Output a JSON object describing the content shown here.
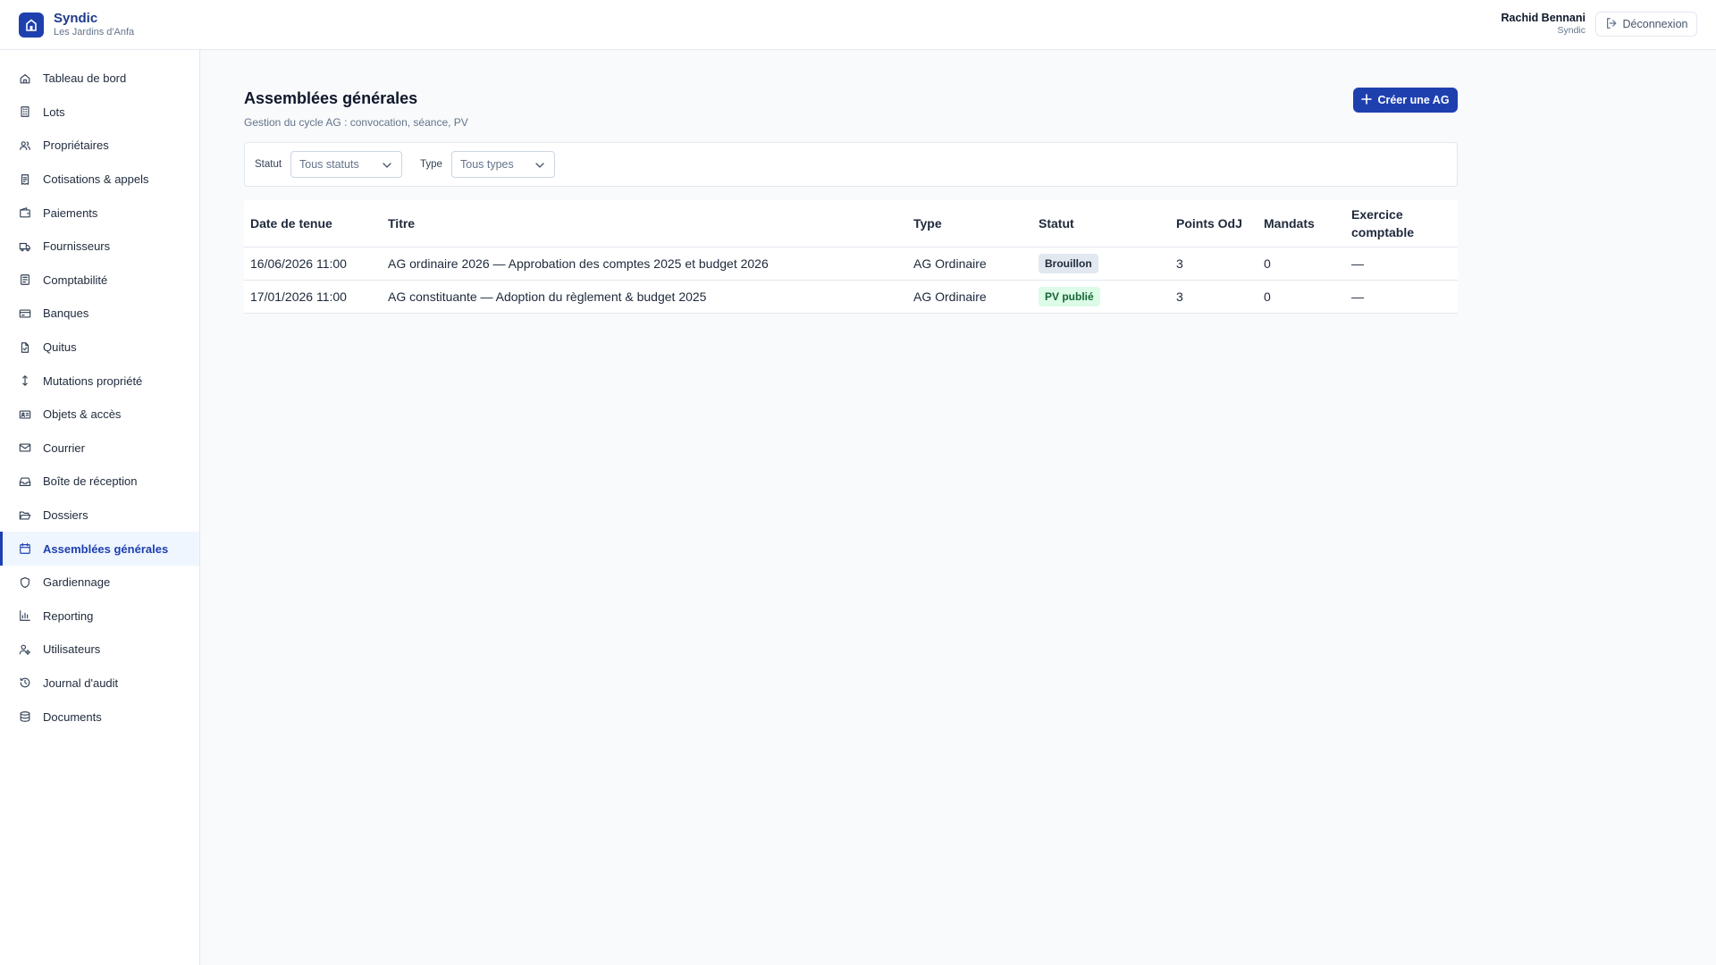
{
  "app": {
    "name": "Syndic",
    "subtitle": "Les Jardins d'Anfa"
  },
  "user": {
    "name": "Rachid Bennani",
    "role": "Syndic",
    "logout_label": "Déconnexion"
  },
  "sidebar": {
    "items": [
      {
        "label": "Tableau de bord",
        "icon": "home-icon"
      },
      {
        "label": "Lots",
        "icon": "building-icon"
      },
      {
        "label": "Propriétaires",
        "icon": "users-icon"
      },
      {
        "label": "Cotisations & appels",
        "icon": "receipt-icon"
      },
      {
        "label": "Paiements",
        "icon": "wallet-icon"
      },
      {
        "label": "Fournisseurs",
        "icon": "truck-icon"
      },
      {
        "label": "Comptabilité",
        "icon": "ledger-icon"
      },
      {
        "label": "Banques",
        "icon": "credit-card-icon"
      },
      {
        "label": "Quitus",
        "icon": "file-check-icon"
      },
      {
        "label": "Mutations propriété",
        "icon": "arrows-vertical-icon"
      },
      {
        "label": "Objets & accès",
        "icon": "id-card-icon"
      },
      {
        "label": "Courrier",
        "icon": "mail-icon"
      },
      {
        "label": "Boîte de réception",
        "icon": "inbox-icon"
      },
      {
        "label": "Dossiers",
        "icon": "folder-open-icon"
      },
      {
        "label": "Assemblées générales",
        "icon": "calendar-icon",
        "active": true
      },
      {
        "label": "Gardiennage",
        "icon": "shield-icon"
      },
      {
        "label": "Reporting",
        "icon": "bar-chart-icon"
      },
      {
        "label": "Utilisateurs",
        "icon": "user-cog-icon"
      },
      {
        "label": "Journal d'audit",
        "icon": "history-icon"
      },
      {
        "label": "Documents",
        "icon": "database-icon"
      }
    ]
  },
  "page": {
    "title": "Assemblées générales",
    "subtitle": "Gestion du cycle AG : convocation, séance, PV",
    "create_label": "Créer une AG"
  },
  "filters": {
    "status_label": "Statut",
    "status_value": "Tous statuts",
    "type_label": "Type",
    "type_value": "Tous types"
  },
  "table": {
    "headers": {
      "date": "Date de tenue",
      "title": "Titre",
      "type": "Type",
      "status": "Statut",
      "points": "Points OdJ",
      "mandates": "Mandats",
      "exercise": "Exercice comptable"
    },
    "rows": [
      {
        "date": "16/06/2026 11:00",
        "title": "AG ordinaire 2026 — Approbation des comptes 2025 et budget 2026",
        "type": "AG Ordinaire",
        "status": "Brouillon",
        "points": "3",
        "mandates": "0",
        "exercise": "—"
      },
      {
        "date": "17/01/2026 11:00",
        "title": "AG constituante — Adoption du règlement & budget 2025",
        "type": "AG Ordinaire",
        "status": "PV publié",
        "points": "3",
        "mandates": "0",
        "exercise": "—"
      }
    ]
  },
  "colors": {
    "accent": "#1e40af",
    "badge_draft_bg": "#e2e8f0",
    "badge_published_bg": "#dcfce7",
    "badge_published_fg": "#166534"
  }
}
